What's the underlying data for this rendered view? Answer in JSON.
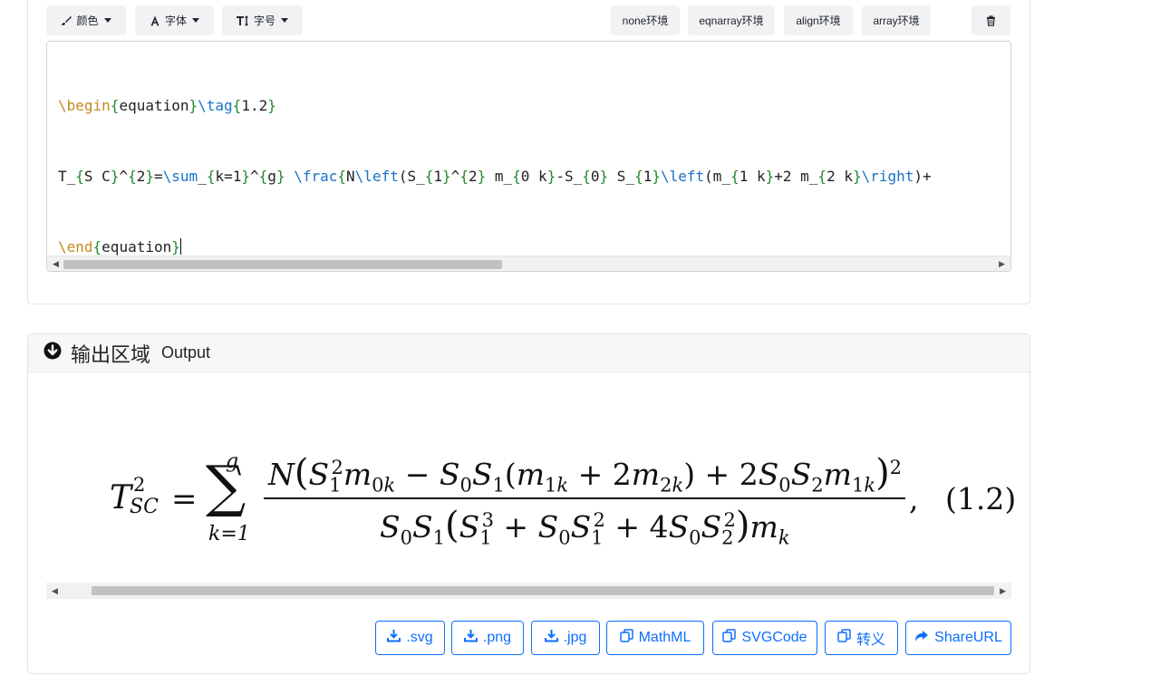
{
  "editor": {
    "toolbar": {
      "color_label": "颜色",
      "font_label": "字体",
      "font_size_label": "字号",
      "env_buttons": [
        "none环境",
        "eqnarray环境",
        "align环境",
        "array环境"
      ]
    },
    "code": {
      "line1": [
        {
          "t": "\\begin",
          "c": "kw"
        },
        {
          "t": "{",
          "c": "br"
        },
        {
          "t": "equation",
          "c": ""
        },
        {
          "t": "}",
          "c": "br"
        },
        {
          "t": "\\tag",
          "c": "cmd"
        },
        {
          "t": "{",
          "c": "br"
        },
        {
          "t": "1.2",
          "c": ""
        },
        {
          "t": "}",
          "c": "br"
        }
      ],
      "line2": [
        {
          "t": "T_",
          "c": ""
        },
        {
          "t": "{",
          "c": "br"
        },
        {
          "t": "S C",
          "c": ""
        },
        {
          "t": "}",
          "c": "br"
        },
        {
          "t": "^",
          "c": ""
        },
        {
          "t": "{",
          "c": "br"
        },
        {
          "t": "2",
          "c": ""
        },
        {
          "t": "}",
          "c": "br"
        },
        {
          "t": "=",
          "c": ""
        },
        {
          "t": "\\sum",
          "c": "cmd"
        },
        {
          "t": "_",
          "c": ""
        },
        {
          "t": "{",
          "c": "br"
        },
        {
          "t": "k=1",
          "c": ""
        },
        {
          "t": "}",
          "c": "br"
        },
        {
          "t": "^",
          "c": ""
        },
        {
          "t": "{",
          "c": "br"
        },
        {
          "t": "g",
          "c": ""
        },
        {
          "t": "}",
          "c": "br"
        },
        {
          "t": " ",
          "c": ""
        },
        {
          "t": "\\frac",
          "c": "cmd"
        },
        {
          "t": "{",
          "c": "br"
        },
        {
          "t": "N",
          "c": ""
        },
        {
          "t": "\\left",
          "c": "cmd"
        },
        {
          "t": "(S_",
          "c": ""
        },
        {
          "t": "{",
          "c": "br"
        },
        {
          "t": "1",
          "c": ""
        },
        {
          "t": "}",
          "c": "br"
        },
        {
          "t": "^",
          "c": ""
        },
        {
          "t": "{",
          "c": "br"
        },
        {
          "t": "2",
          "c": ""
        },
        {
          "t": "}",
          "c": "br"
        },
        {
          "t": " m_",
          "c": ""
        },
        {
          "t": "{",
          "c": "br"
        },
        {
          "t": "0 k",
          "c": ""
        },
        {
          "t": "}",
          "c": "br"
        },
        {
          "t": "-S_",
          "c": ""
        },
        {
          "t": "{",
          "c": "br"
        },
        {
          "t": "0",
          "c": ""
        },
        {
          "t": "}",
          "c": "br"
        },
        {
          "t": " S_",
          "c": ""
        },
        {
          "t": "{",
          "c": "br"
        },
        {
          "t": "1",
          "c": ""
        },
        {
          "t": "}",
          "c": "br"
        },
        {
          "t": "\\left",
          "c": "cmd"
        },
        {
          "t": "(m_",
          "c": ""
        },
        {
          "t": "{",
          "c": "br"
        },
        {
          "t": "1 k",
          "c": ""
        },
        {
          "t": "}",
          "c": "br"
        },
        {
          "t": "+2 m_",
          "c": ""
        },
        {
          "t": "{",
          "c": "br"
        },
        {
          "t": "2 k",
          "c": ""
        },
        {
          "t": "}",
          "c": "br"
        },
        {
          "t": "\\right",
          "c": "cmd"
        },
        {
          "t": ")+",
          "c": ""
        }
      ],
      "line3": [
        {
          "t": "\\end",
          "c": "kw"
        },
        {
          "t": "{",
          "c": "br"
        },
        {
          "t": "equation",
          "c": ""
        },
        {
          "t": "}",
          "c": "br"
        }
      ]
    },
    "scroll_fraction": 0.47
  },
  "output": {
    "title": "输出区域",
    "subtitle": "Output",
    "equation": {
      "lhs_base": "T",
      "lhs_sup": "2",
      "lhs_sub": "SC",
      "equals": "=",
      "sum_symbol": "∑",
      "sum_upper": "g",
      "sum_lower": "k=1",
      "comma": ",",
      "tag": "(1.2)"
    },
    "buttons": [
      ".svg",
      ".png",
      ".jpg",
      "MathML",
      "SVGCode",
      "转义",
      "ShareURL"
    ],
    "scroll_fraction": 0.94
  },
  "colors": {
    "accent": "#0d6efd",
    "keyword": "#c48a1e",
    "command": "#1a73c7",
    "brace": "#1f8a2e"
  }
}
